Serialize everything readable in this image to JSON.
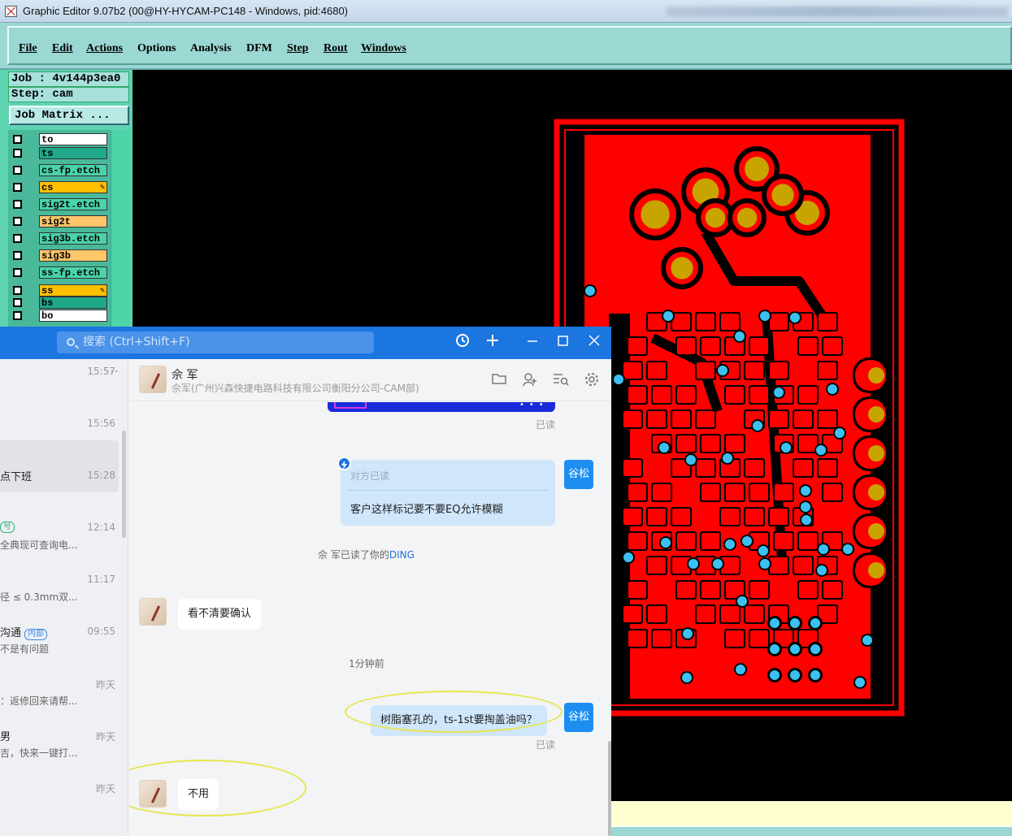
{
  "window": {
    "title": "Graphic Editor 9.07b2 (00@HY-HYCAM-PC148 - Windows, pid:4680)"
  },
  "menu": [
    "File",
    "Edit",
    "Actions",
    "Options",
    "Analysis",
    "DFM",
    "Step",
    "Rout",
    "Windows"
  ],
  "info": {
    "job": "Job : 4v144p3ea0",
    "step": "Step: cam",
    "job_matrix": "Job Matrix ..."
  },
  "layers": [
    {
      "name": "to",
      "color": "#ffffff"
    },
    {
      "name": "ts",
      "color": "#1fa88a"
    },
    {
      "name": "cs-fp.etch",
      "color": "#4ad3a9"
    },
    {
      "name": "cs",
      "color": "#ffc000",
      "pen": "✎"
    },
    {
      "name": "sig2t.etch",
      "color": "#4ad3a9"
    },
    {
      "name": "sig2t",
      "color": "#ffc66a"
    },
    {
      "name": "sig3b.etch",
      "color": "#4ad3a9"
    },
    {
      "name": "sig3b",
      "color": "#ffc66a"
    },
    {
      "name": "ss-fp.etch",
      "color": "#4ad3a9"
    },
    {
      "name": "ss",
      "color": "#ffc000",
      "pen": "✎"
    },
    {
      "name": "bs",
      "color": "#1fa88a"
    },
    {
      "name": "bo",
      "color": "#ffffff"
    }
  ],
  "chat": {
    "search_placeholder": "搜索 (Ctrl+Shift+F)",
    "sidebar_more": "···",
    "conversations": [
      {
        "time": "15:57",
        "line1": "",
        "line2": ""
      },
      {
        "time": "15:56",
        "line1": "",
        "line2": ""
      },
      {
        "time": "15:28",
        "line1": "点下班",
        "line2": ""
      },
      {
        "time": "12:14",
        "line1": "",
        "tag": "号",
        "line2": "全典现可查询电..."
      },
      {
        "time": "11:17",
        "line1": "",
        "line2": "径 ≤ 0.3mm双..."
      },
      {
        "time": "09:55",
        "line1": "沟通",
        "tag": "内部",
        "line2": "不是有问题"
      },
      {
        "time": "昨天",
        "line1": "",
        "line2": "：返修回来请帮..."
      },
      {
        "time": "昨天",
        "line1": "男",
        "line2": "吉，快来一键打..."
      },
      {
        "time": "昨天",
        "line1": "",
        "line2": ""
      }
    ],
    "contact": {
      "name": "佘 军",
      "org": "佘军(广州兴森快捷电路科技有限公司衡阳分公司-CAM部)"
    },
    "self_name": "谷松",
    "messages": {
      "read1": "已读",
      "quote_status": "对方已读",
      "quote_text": "客户这样标记要不要EQ允许模糊",
      "ding_prefix": "佘 军已读了你的",
      "ding_word": "DING",
      "reply1": "看不清要确认",
      "time_sep": "1分钟前",
      "question": "树脂塞孔的，ts-1st要掏盖油吗？",
      "read2": "已读",
      "reply2": "不用"
    }
  },
  "colors": {
    "pcb_copper": "#ff0000",
    "pad_gold": "#c8a400",
    "via_cyan": "#3cc0f0",
    "chat_blue": "#1c76e0"
  }
}
